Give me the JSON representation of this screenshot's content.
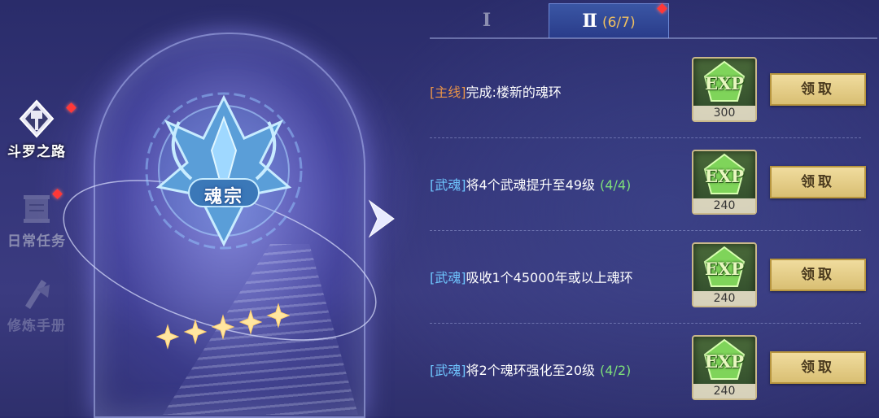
{
  "nav": {
    "items": [
      {
        "label": "斗罗之路",
        "badge": true,
        "active": true
      },
      {
        "label": "日常任务",
        "badge": true,
        "active": false
      },
      {
        "label": "修炼手册",
        "badge": false,
        "active": false
      }
    ]
  },
  "emblem": {
    "title": "魂宗",
    "stars": 5
  },
  "tabs": {
    "tab1_label": "Ⅰ",
    "tab2_label": "Ⅱ",
    "tab2_progress": "(6/7)",
    "tab2_badge": true
  },
  "quests": [
    {
      "tag": "[主线]",
      "text": "完成:楼新的魂环",
      "progress": "",
      "reward_label": "EXP",
      "reward_amount": "300",
      "button": "领取"
    },
    {
      "tag": "[武魂]",
      "text": "将4个武魂提升至49级",
      "progress": "(4/4)",
      "reward_label": "EXP",
      "reward_amount": "240",
      "button": "领取"
    },
    {
      "tag": "[武魂]",
      "text": "吸收1个45000年或以上魂环",
      "progress": "",
      "reward_label": "EXP",
      "reward_amount": "240",
      "button": "领取"
    },
    {
      "tag": "[武魂]",
      "text": "将2个魂环强化至20级",
      "progress": "(4/2)",
      "reward_label": "EXP",
      "reward_amount": "240",
      "button": "领取"
    }
  ],
  "colors": {
    "main_tag": "#e89348",
    "soul_tag": "#6fc6ff",
    "progress": "#7ee07a",
    "button": "#e6d08a"
  }
}
